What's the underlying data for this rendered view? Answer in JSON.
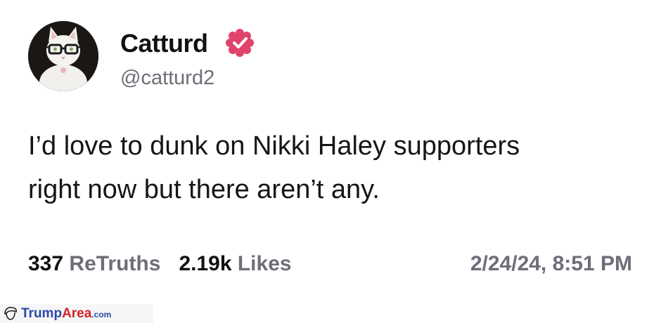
{
  "post": {
    "author": {
      "display_name": "Catturd",
      "handle": "@catturd2",
      "verified": true,
      "avatar_icon": "cat-with-glasses-avatar"
    },
    "text_line_1": "I’d love to dunk on Nikki Haley supporters",
    "text_line_2": "right now but there aren’t any.",
    "stats": {
      "retruths_count": "337",
      "retruths_label": "ReTruths",
      "likes_count": "2.19k",
      "likes_label": "Likes"
    },
    "timestamp": "2/24/24, 8:51 PM"
  },
  "watermark": {
    "part_1": "Trump",
    "part_2": "Area",
    "part_3": ".com",
    "icon": "trump-hair-icon"
  },
  "colors": {
    "verified_badge": "#e0446c",
    "secondary_text": "#6e6e78",
    "primary_text": "#111111",
    "watermark_blue": "#2a4aa8",
    "watermark_red": "#d32127"
  }
}
